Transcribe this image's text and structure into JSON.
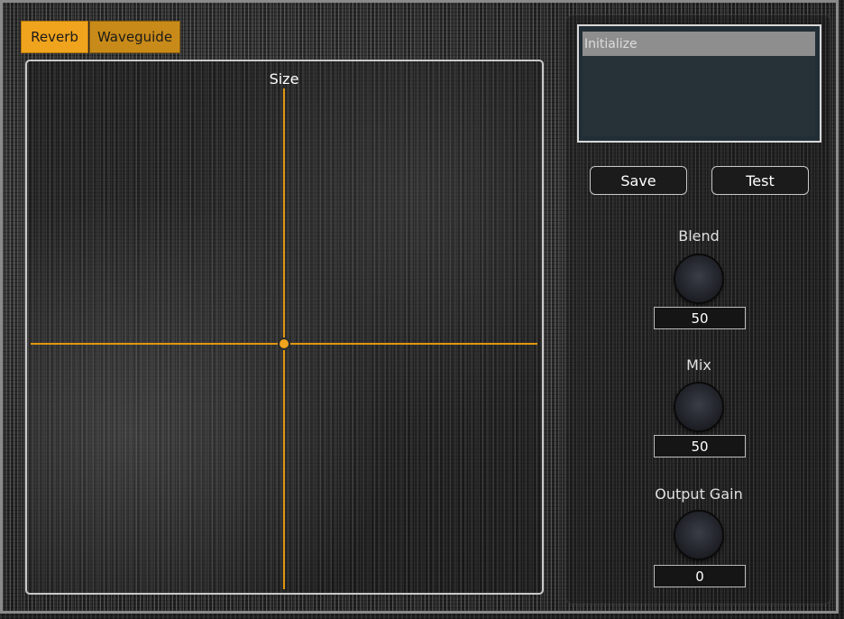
{
  "tabs": [
    {
      "label": "Reverb",
      "active": true
    },
    {
      "label": "Waveguide",
      "active": false
    }
  ],
  "xy_pad": {
    "y_axis_label": "Size"
  },
  "presets": {
    "items": [
      "Initialize"
    ],
    "selected": "Initialize"
  },
  "buttons": {
    "save_label": "Save",
    "test_label": "Test"
  },
  "knobs": [
    {
      "label": "Blend",
      "value": "50"
    },
    {
      "label": "Mix",
      "value": "50"
    },
    {
      "label": "Output Gain",
      "value": "0"
    }
  ],
  "colors": {
    "accent": "#f0a31c",
    "accent_dark": "#c88a18",
    "preset_selected_bg": "#8e8e8e",
    "preset_list_bg": "#263238"
  }
}
